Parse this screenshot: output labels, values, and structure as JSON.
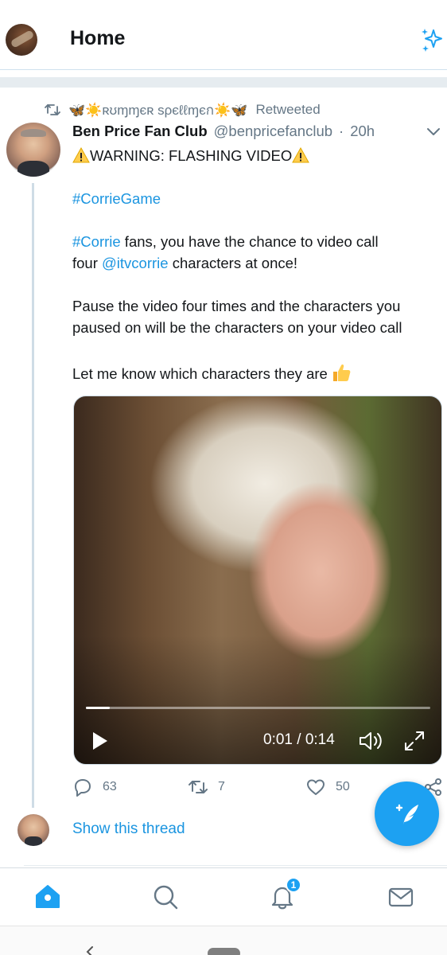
{
  "header": {
    "title": "Home"
  },
  "tweet": {
    "retweeted_by": "🦋☀️ʀʊɱɱєʀ ѕρєℓℓɱєก☀️🦋",
    "retweeted_label": "Retweeted",
    "author_name": "Ben Price Fan Club",
    "author_handle": "@benpricefanclub",
    "separator": "·",
    "time": "20h",
    "lines": {
      "warning": "WARNING: FLASHING VIDEO",
      "hashtag_game": "#CorrieGame",
      "hashtag_corrie": "#Corrie",
      "line3_rest": " fans, you have the chance to video call",
      "line4_start": "four ",
      "mention": "@itvcorrie",
      "line4_rest": " characters at once!",
      "line5": "Pause the video four times and the characters you",
      "line6": "paused on will be the characters on your video call",
      "line7": "Let me know which characters they are"
    },
    "video": {
      "time_display": "0:01 / 0:14",
      "progress": 0.07
    },
    "actions": {
      "replies": "63",
      "retweets": "7",
      "likes": "50"
    },
    "show_thread": "Show this thread"
  },
  "notifications_badge": "1",
  "colors": {
    "accent": "#1da1f2",
    "link": "#1b95e0",
    "secondary_text": "#657786"
  },
  "icons": {
    "header_right": "sparkle-icon",
    "nav": [
      "home-icon",
      "search-icon",
      "bell-icon",
      "mail-icon"
    ]
  }
}
